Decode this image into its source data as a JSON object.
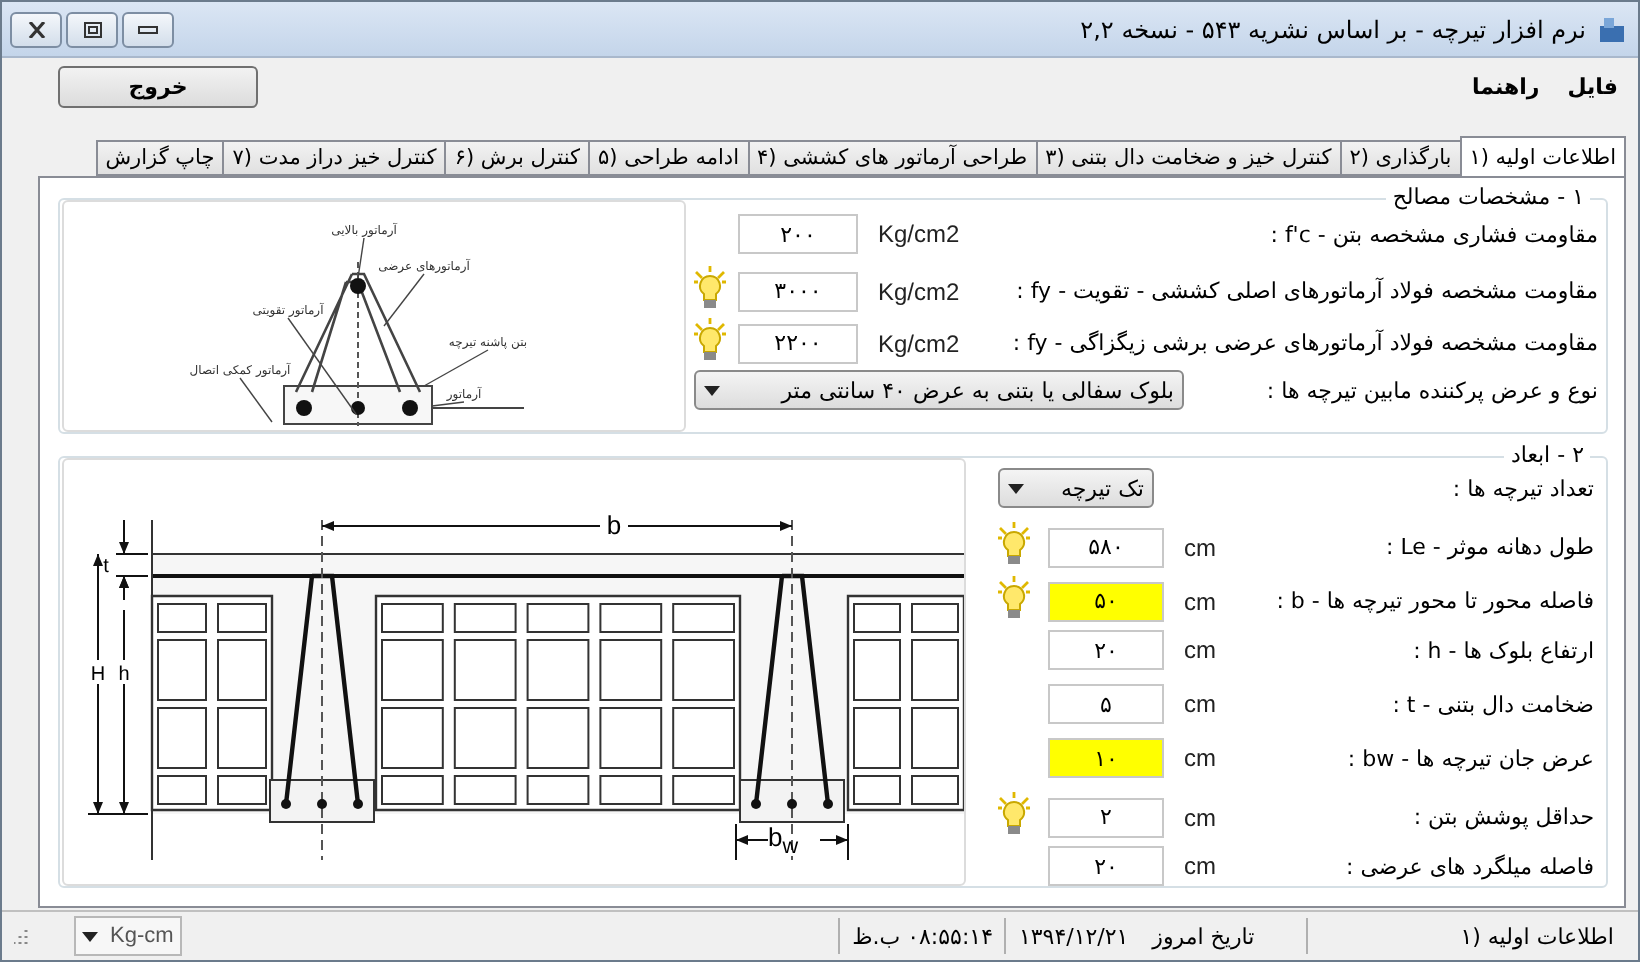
{
  "window": {
    "title": "نرم افزار تیرچه - بر اساس نشریه ۵۴۳ - نسخه ۲,۲"
  },
  "menu": [
    "فایل",
    "راهنما"
  ],
  "exit_button": "خروج",
  "tabs": [
    {
      "label": "اطلاعات اولیه (۱",
      "selected": true
    },
    {
      "label": "بارگذاری (۲",
      "selected": false
    },
    {
      "label": "کنترل خیز و ضخامت دال بتنی (۳",
      "selected": false
    },
    {
      "label": "طراحی آرماتور های کششی (۴",
      "selected": false
    },
    {
      "label": "ادامه طراحی (۵",
      "selected": false
    },
    {
      "label": "کنترل برش (۶",
      "selected": false
    },
    {
      "label": "کنترل خیز دراز مدت (۷",
      "selected": false
    },
    {
      "label": "چاپ گزارش",
      "selected": false
    }
  ],
  "materials": {
    "title": "۱ - مشخصات مصالح",
    "diagram_labels": [
      "آرماتور بالایی",
      "آرماتورهای عرضی",
      "آرماتور تقویتی",
      "بتن پاشنه تیرچه",
      "آرماتور کمکی اتصال",
      "آرماتور"
    ],
    "rows": [
      {
        "kind": "input",
        "label": "مقاومت فشاری مشخصه بتن - f'c :",
        "unit": "Kg/cm2",
        "value": "۲۰۰",
        "hint": false,
        "highlighted": false
      },
      {
        "kind": "input",
        "label": "مقاومت مشخصه فولاد آرماتورهای اصلی کششی - تقویت - fy :",
        "unit": "Kg/cm2",
        "value": "۳۰۰۰",
        "hint": true,
        "highlighted": false
      },
      {
        "kind": "input",
        "label": "مقاومت مشخصه فولاد آرماتورهای عرضی برشی زیگزاگی - fy :",
        "unit": "Kg/cm2",
        "value": "۲۲۰۰",
        "hint": true,
        "highlighted": false
      },
      {
        "kind": "select",
        "label": "نوع و عرض پرکننده مابین تیرچه ها :",
        "value": "بلوک سفالی یا بتنی به عرض ۴۰ سانتی متر"
      }
    ]
  },
  "dimensions": {
    "title": "۲ - ابعاد",
    "diagram_labels": [
      "b",
      "t",
      "H",
      "h",
      "b$_{w}$"
    ],
    "rows": [
      {
        "kind": "select",
        "label": "تعداد تیرچه ها :",
        "value": "تک تیرچه"
      },
      {
        "kind": "input",
        "label": "طول دهانه موثر - Le :",
        "unit": "cm",
        "value": "۵۸۰",
        "hint": true,
        "highlighted": false
      },
      {
        "kind": "input",
        "label": "فاصله محور تا محور تیرچه ها - b :",
        "unit": "cm",
        "value": "۵۰",
        "hint": true,
        "highlighted": true
      },
      {
        "kind": "input",
        "label": "ارتفاع بلوک ها - h :",
        "unit": "cm",
        "value": "۲۰",
        "hint": false,
        "highlighted": false
      },
      {
        "kind": "input",
        "label": "ضخامت دال بتنی - t :",
        "unit": "cm",
        "value": "۵",
        "hint": false,
        "highlighted": false
      },
      {
        "kind": "input",
        "label": "عرض جان تیرچه ها - bw :",
        "unit": "cm",
        "value": "۱۰",
        "hint": false,
        "highlighted": true
      },
      {
        "kind": "input",
        "label": "حداقل پوشش بتن :",
        "unit": "cm",
        "value": "۲",
        "hint": true,
        "highlighted": false
      },
      {
        "kind": "input",
        "label": "فاصله میلگرد های عرضی :",
        "unit": "cm",
        "value": "۲۰",
        "hint": false,
        "highlighted": false
      }
    ]
  },
  "status_bar": {
    "section": "اطلاعات اولیه (۱",
    "date_label": "تاریخ امروز",
    "date": "۱۳۹۴/۱۲/۲۱",
    "time": "۰۸:۵۵:۱۴ ب.ظ",
    "units": "Kg-cm"
  }
}
